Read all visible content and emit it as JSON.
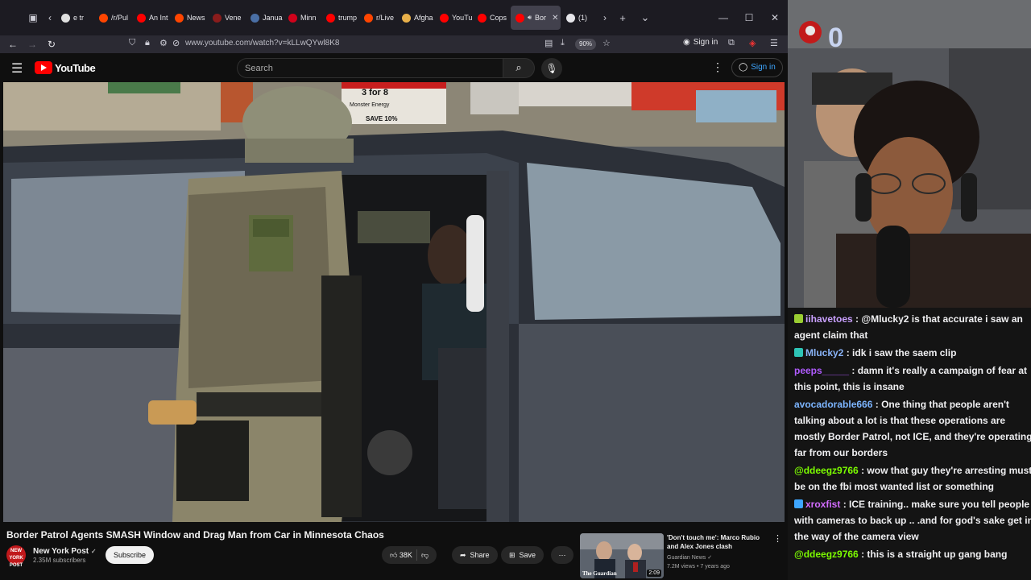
{
  "browser": {
    "tabs": [
      {
        "label": "e tr",
        "favicon": "#e0e0e0",
        "active": false
      },
      {
        "label": "/r/Pul",
        "favicon": "#ff4500",
        "active": false
      },
      {
        "label": "An Int",
        "favicon": "#ff0000",
        "active": false
      },
      {
        "label": "News",
        "favicon": "#ff4500",
        "active": false
      },
      {
        "label": "Vene",
        "favicon": "#8a1c1c",
        "active": false
      },
      {
        "label": "Janua",
        "favicon": "#4a6fa5",
        "active": false
      },
      {
        "label": "Minn",
        "favicon": "#d0021b",
        "active": false
      },
      {
        "label": "trump",
        "favicon": "#ff0000",
        "active": false
      },
      {
        "label": "r/Live",
        "favicon": "#ff4500",
        "active": false
      },
      {
        "label": "Afgha",
        "favicon": "#e8b04a",
        "active": false
      },
      {
        "label": "YouTu",
        "favicon": "#ff0000",
        "active": false
      },
      {
        "label": "Cops",
        "favicon": "#ff0000",
        "active": false
      },
      {
        "label": "Bor",
        "favicon": "#ff0000",
        "active": true
      },
      {
        "label": "(1) ",
        "favicon": "#e6e6ea",
        "active": false
      }
    ],
    "url": "www.youtube.com/watch?v=kLLwQYwl8K8",
    "zoom": "90%",
    "sign_in": "Sign in"
  },
  "youtube": {
    "logo_text": "YouTube",
    "search_placeholder": "Search",
    "sign_in": "Sign in",
    "video": {
      "title": "Border Patrol Agents SMASH Window and Drag Man from Car in Minnesota Chaos",
      "channel": "New York Post",
      "channel_avatar_text": "NEW YORK POST",
      "subscribers": "2.35M subscribers",
      "subscribe_label": "Subscribe",
      "likes": "38K",
      "share_label": "Share",
      "save_label": "Save",
      "overlay_sign": "3 for 8",
      "overlay_sign_brand": "Monster Energy",
      "overlay_sign_save": "SAVE 10%"
    },
    "recommendation": {
      "title": "'Don't touch me': Marco Rubio and Alex Jones clash",
      "channel": "Guardian News",
      "meta": "7.2M views • 7 years ago",
      "duration": "2:09",
      "thumb_label": "The Guardian"
    }
  },
  "stream": {
    "cam_counter": "0"
  },
  "chat": {
    "messages": [
      {
        "user": "iihavetoes",
        "color": "#c9a0ff",
        "badge": "#9acd32",
        "text": "@Mlucky2 is that accurate i saw an agent claim that"
      },
      {
        "user": "Mlucky2",
        "color": "#8ab4f8",
        "badge": "#2ec4b6",
        "text": "idk i saw the saem clip"
      },
      {
        "user": "peeps_____",
        "color": "#b05bff",
        "badge": "",
        "text": "damn it's really a campaign of fear at this point, this is insane"
      },
      {
        "user": "avocadorable666",
        "color": "#7cb5ff",
        "badge": "",
        "text": "One thing that people aren't talking about a lot is that these operations are mostly Border Patrol, not ICE, and they're operating far from our borders"
      },
      {
        "user": "@ddeegz9766",
        "color": "#7cfc00",
        "badge": "",
        "text": "wow that guy they're arresting must be on the fbi most wanted list or something"
      },
      {
        "user": "xroxfist",
        "color": "#d36cff",
        "badge": "#3ea6ff",
        "text": "ICE training.. make sure you tell people with cameras to back up .. .and for god's sake get in the way of the camera view"
      },
      {
        "user": "@ddeegz9766",
        "color": "#7cfc00",
        "badge": "",
        "text": "this is a straight up gang bang"
      }
    ]
  }
}
